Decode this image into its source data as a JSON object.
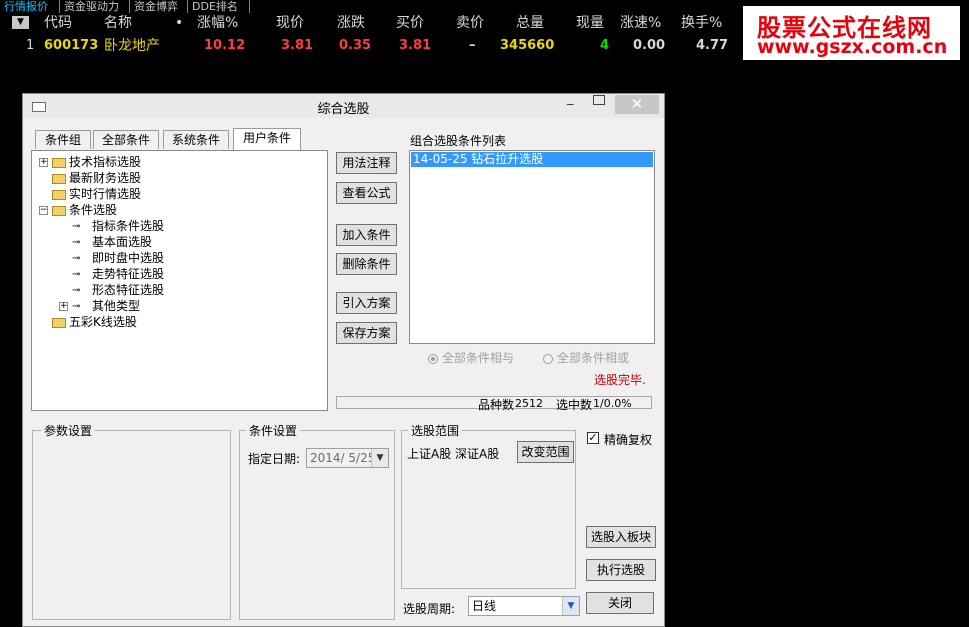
{
  "top_tabs": [
    "行情报价",
    "资金驱动力",
    "资金博弈",
    "DDE排名"
  ],
  "table": {
    "headers": [
      "代码",
      "名称",
      "•",
      "涨幅%",
      "现价",
      "涨跌",
      "买价",
      "卖价",
      "总量",
      "现量",
      "涨速%",
      "换手%"
    ],
    "row": {
      "index": "1",
      "code": "600173",
      "name": "卧龙地产",
      "change_pct": "10.12",
      "price": "3.81",
      "change": "0.35",
      "bid": "3.81",
      "ask": "–",
      "volume": "345660",
      "cur_vol": "4",
      "speed": "0.00",
      "turnover": "4.77"
    }
  },
  "logo": {
    "line1": "股票公式在线网",
    "line2": "www.gszx.com.cn"
  },
  "dialog": {
    "title": "综合选股",
    "tabs": [
      "条件组",
      "全部条件",
      "系统条件",
      "用户条件"
    ],
    "tree": {
      "items": [
        "技术指标选股",
        "最新财务选股",
        "实时行情选股",
        "条件选股",
        "指标条件选股",
        "基本面选股",
        "即时盘中选股",
        "走势特征选股",
        "形态特征选股",
        "其他类型",
        "五彩K线选股"
      ]
    },
    "buttons": {
      "usage": "用法注释",
      "view_formula": "查看公式",
      "add_condition": "加入条件",
      "delete_condition": "删除条件",
      "import_plan": "引入方案",
      "save_plan": "保存方案",
      "change_range": "改变范围",
      "select_to_block": "选股入板块",
      "run_select": "执行选股",
      "close": "关闭"
    },
    "list_label": "组合选股条件列表",
    "list_items": [
      "14-05-25 钻石拉升选股"
    ],
    "radio_and": "全部条件相与",
    "radio_or": "全部条件相或",
    "status": "选股完毕.",
    "stock_count_label": "品种数",
    "stock_count": "2512",
    "selected_label": "选中数",
    "selected": "1/0.0%",
    "param_group": "参数设置",
    "cond_group": "条件设置",
    "date_label": "指定日期:",
    "date_value": "2014/ 5/25",
    "range_group": "选股范围",
    "range_text": "上证A股 深证A股",
    "exact_label": "精确复权",
    "period_label": "选股周期:",
    "period_value": "日线"
  },
  "colors": {
    "red": "#ff3c3c",
    "yellow": "#e8d800",
    "green": "#00e000",
    "logo_red": "#e8000a"
  }
}
